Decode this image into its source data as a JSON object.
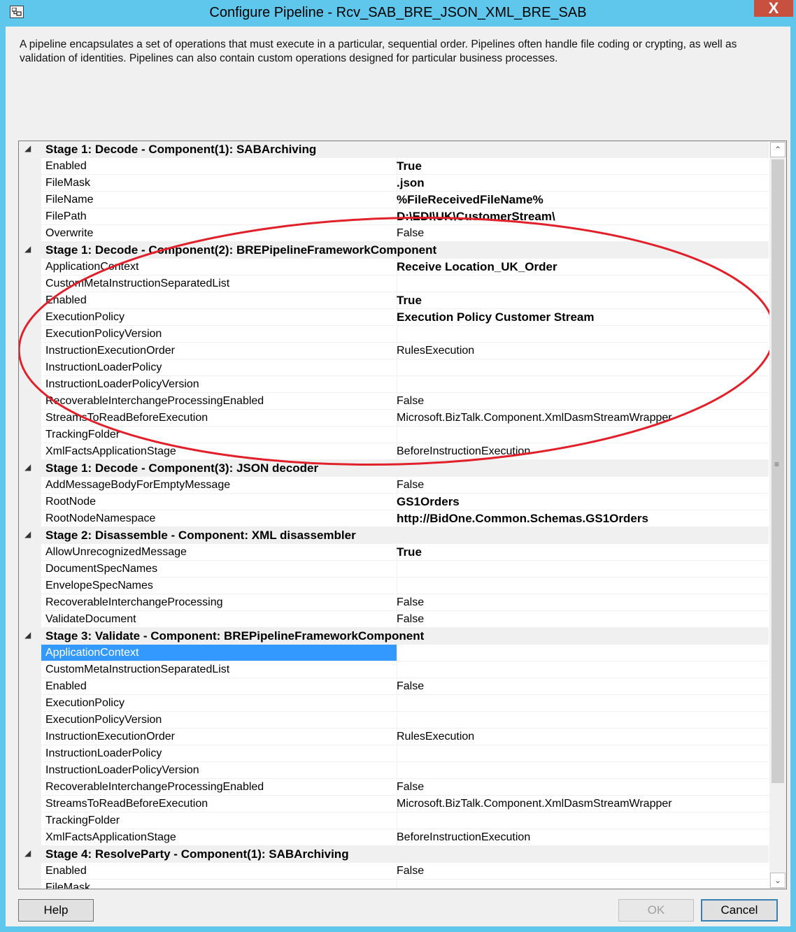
{
  "window": {
    "title": "Configure Pipeline - Rcv_SAB_BRE_JSON_XML_BRE_SAB",
    "close_glyph": "X",
    "icon": "pipeline-app-icon"
  },
  "description": "A pipeline encapsulates a set of operations that must execute in a particular, sequential order. Pipelines often handle file coding or crypting, as well as validation of identities. Pipelines can also contain custom operations designed for particular business processes.",
  "grid": {
    "expander_glyph": "◢",
    "rows": [
      {
        "type": "category",
        "label": "Stage 1: Decode - Component(1): SABArchiving"
      },
      {
        "type": "prop",
        "name": "Enabled",
        "value": "True",
        "bold": true
      },
      {
        "type": "prop",
        "name": "FileMask",
        "value": ".json",
        "bold": true
      },
      {
        "type": "prop",
        "name": "FileName",
        "value": "%FileReceivedFileName%",
        "bold": true
      },
      {
        "type": "prop",
        "name": "FilePath",
        "value": "D:\\EDI\\UK\\CustomerStream\\",
        "bold": true
      },
      {
        "type": "prop",
        "name": "Overwrite",
        "value": "False",
        "bold": false
      },
      {
        "type": "category",
        "label": "Stage 1: Decode - Component(2): BREPipelineFrameworkComponent",
        "highlighted": true
      },
      {
        "type": "prop",
        "name": "ApplicationContext",
        "value": "Receive Location_UK_Order",
        "bold": true
      },
      {
        "type": "prop",
        "name": "CustomMetaInstructionSeparatedList",
        "value": "",
        "bold": false
      },
      {
        "type": "prop",
        "name": "Enabled",
        "value": "True",
        "bold": true
      },
      {
        "type": "prop",
        "name": "ExecutionPolicy",
        "value": "Execution Policy Customer Stream",
        "bold": true
      },
      {
        "type": "prop",
        "name": "ExecutionPolicyVersion",
        "value": "",
        "bold": false
      },
      {
        "type": "prop",
        "name": "InstructionExecutionOrder",
        "value": "RulesExecution",
        "bold": false
      },
      {
        "type": "prop",
        "name": "InstructionLoaderPolicy",
        "value": "",
        "bold": false
      },
      {
        "type": "prop",
        "name": "InstructionLoaderPolicyVersion",
        "value": "",
        "bold": false
      },
      {
        "type": "prop",
        "name": "RecoverableInterchangeProcessingEnabled",
        "value": "False",
        "bold": false
      },
      {
        "type": "prop",
        "name": "StreamsToReadBeforeExecution",
        "value": "Microsoft.BizTalk.Component.XmlDasmStreamWrapper",
        "bold": false
      },
      {
        "type": "prop",
        "name": "TrackingFolder",
        "value": "",
        "bold": false
      },
      {
        "type": "prop",
        "name": "XmlFactsApplicationStage",
        "value": "BeforeInstructionExecution",
        "bold": false
      },
      {
        "type": "category",
        "label": "Stage 1: Decode - Component(3): JSON decoder"
      },
      {
        "type": "prop",
        "name": "AddMessageBodyForEmptyMessage",
        "value": "False",
        "bold": false
      },
      {
        "type": "prop",
        "name": "RootNode",
        "value": "GS1Orders",
        "bold": true
      },
      {
        "type": "prop",
        "name": "RootNodeNamespace",
        "value": "http://BidOne.Common.Schemas.GS1Orders",
        "bold": true
      },
      {
        "type": "category",
        "label": "Stage 2: Disassemble - Component: XML disassembler"
      },
      {
        "type": "prop",
        "name": "AllowUnrecognizedMessage",
        "value": "True",
        "bold": true
      },
      {
        "type": "prop",
        "name": "DocumentSpecNames",
        "value": "",
        "bold": false
      },
      {
        "type": "prop",
        "name": "EnvelopeSpecNames",
        "value": "",
        "bold": false
      },
      {
        "type": "prop",
        "name": "RecoverableInterchangeProcessing",
        "value": "False",
        "bold": false
      },
      {
        "type": "prop",
        "name": "ValidateDocument",
        "value": "False",
        "bold": false
      },
      {
        "type": "category",
        "label": "Stage 3: Validate - Component: BREPipelineFrameworkComponent"
      },
      {
        "type": "prop",
        "name": "ApplicationContext",
        "value": "",
        "bold": false,
        "selected": true
      },
      {
        "type": "prop",
        "name": "CustomMetaInstructionSeparatedList",
        "value": "",
        "bold": false
      },
      {
        "type": "prop",
        "name": "Enabled",
        "value": "False",
        "bold": false
      },
      {
        "type": "prop",
        "name": "ExecutionPolicy",
        "value": "",
        "bold": false
      },
      {
        "type": "prop",
        "name": "ExecutionPolicyVersion",
        "value": "",
        "bold": false
      },
      {
        "type": "prop",
        "name": "InstructionExecutionOrder",
        "value": "RulesExecution",
        "bold": false
      },
      {
        "type": "prop",
        "name": "InstructionLoaderPolicy",
        "value": "",
        "bold": false
      },
      {
        "type": "prop",
        "name": "InstructionLoaderPolicyVersion",
        "value": "",
        "bold": false
      },
      {
        "type": "prop",
        "name": "RecoverableInterchangeProcessingEnabled",
        "value": "False",
        "bold": false
      },
      {
        "type": "prop",
        "name": "StreamsToReadBeforeExecution",
        "value": "Microsoft.BizTalk.Component.XmlDasmStreamWrapper",
        "bold": false
      },
      {
        "type": "prop",
        "name": "TrackingFolder",
        "value": "",
        "bold": false
      },
      {
        "type": "prop",
        "name": "XmlFactsApplicationStage",
        "value": "BeforeInstructionExecution",
        "bold": false
      },
      {
        "type": "category",
        "label": "Stage 4: ResolveParty - Component(1): SABArchiving"
      },
      {
        "type": "prop",
        "name": "Enabled",
        "value": "False",
        "bold": false
      },
      {
        "type": "prop",
        "name": "FileMask",
        "value": "",
        "bold": false
      }
    ]
  },
  "scrollbar": {
    "up_glyph": "⌃",
    "down_glyph": "⌄",
    "grip_glyph": "≡"
  },
  "buttons": {
    "help": "Help",
    "ok": "OK",
    "cancel": "Cancel"
  },
  "colors": {
    "titlebar": "#5fc7eb",
    "close": "#c7503f",
    "selection": "#3399ff",
    "highlight": "#f7f000",
    "annotation": "#e0202a"
  }
}
